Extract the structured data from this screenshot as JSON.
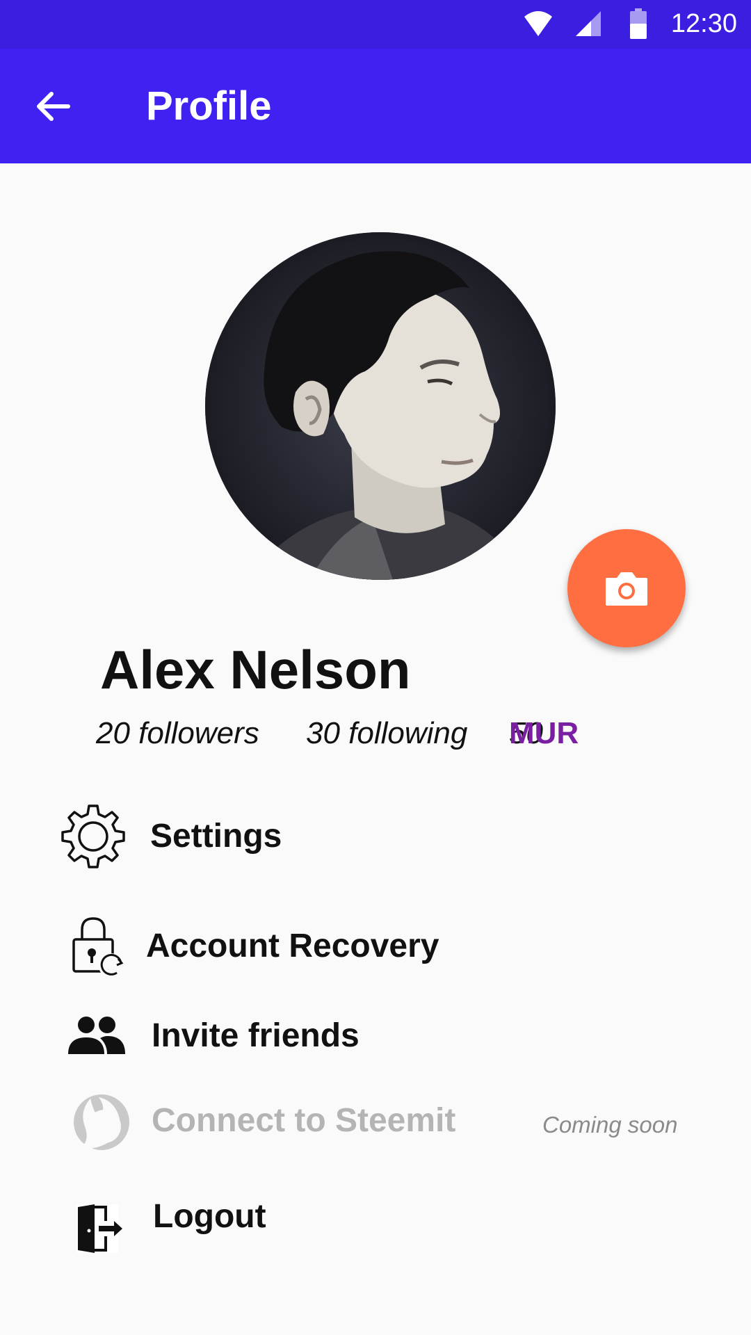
{
  "status_bar": {
    "time": "12:30",
    "icons": [
      "wifi-icon",
      "cell-signal-icon",
      "battery-icon"
    ],
    "background": "#3a1fe0"
  },
  "app_bar": {
    "title": "Profile",
    "back_icon": "arrow-back-icon",
    "background": "#3f22f2"
  },
  "profile": {
    "avatar_alt": "profile photo",
    "camera_icon": "camera-icon",
    "name": "Alex Nelson",
    "followers": "20 followers",
    "following": "30 following",
    "balance_amount": "50",
    "balance_currency": "MUR"
  },
  "menu": [
    {
      "label": "Settings",
      "icon": "gear-icon",
      "enabled": true
    },
    {
      "label": "Account Recovery",
      "icon": "lock-refresh-icon",
      "enabled": true
    },
    {
      "label": "Invite friends",
      "icon": "people-icon",
      "enabled": true
    },
    {
      "label": "Connect to Steemit",
      "icon": "steemit-icon",
      "enabled": false,
      "note": "Coming soon"
    },
    {
      "label": "Logout",
      "icon": "logout-door-icon",
      "enabled": true
    }
  ],
  "colors": {
    "fab": "#ff6e40",
    "currency": "#7b1fa2",
    "disabled_text": "#b4b4b4"
  }
}
